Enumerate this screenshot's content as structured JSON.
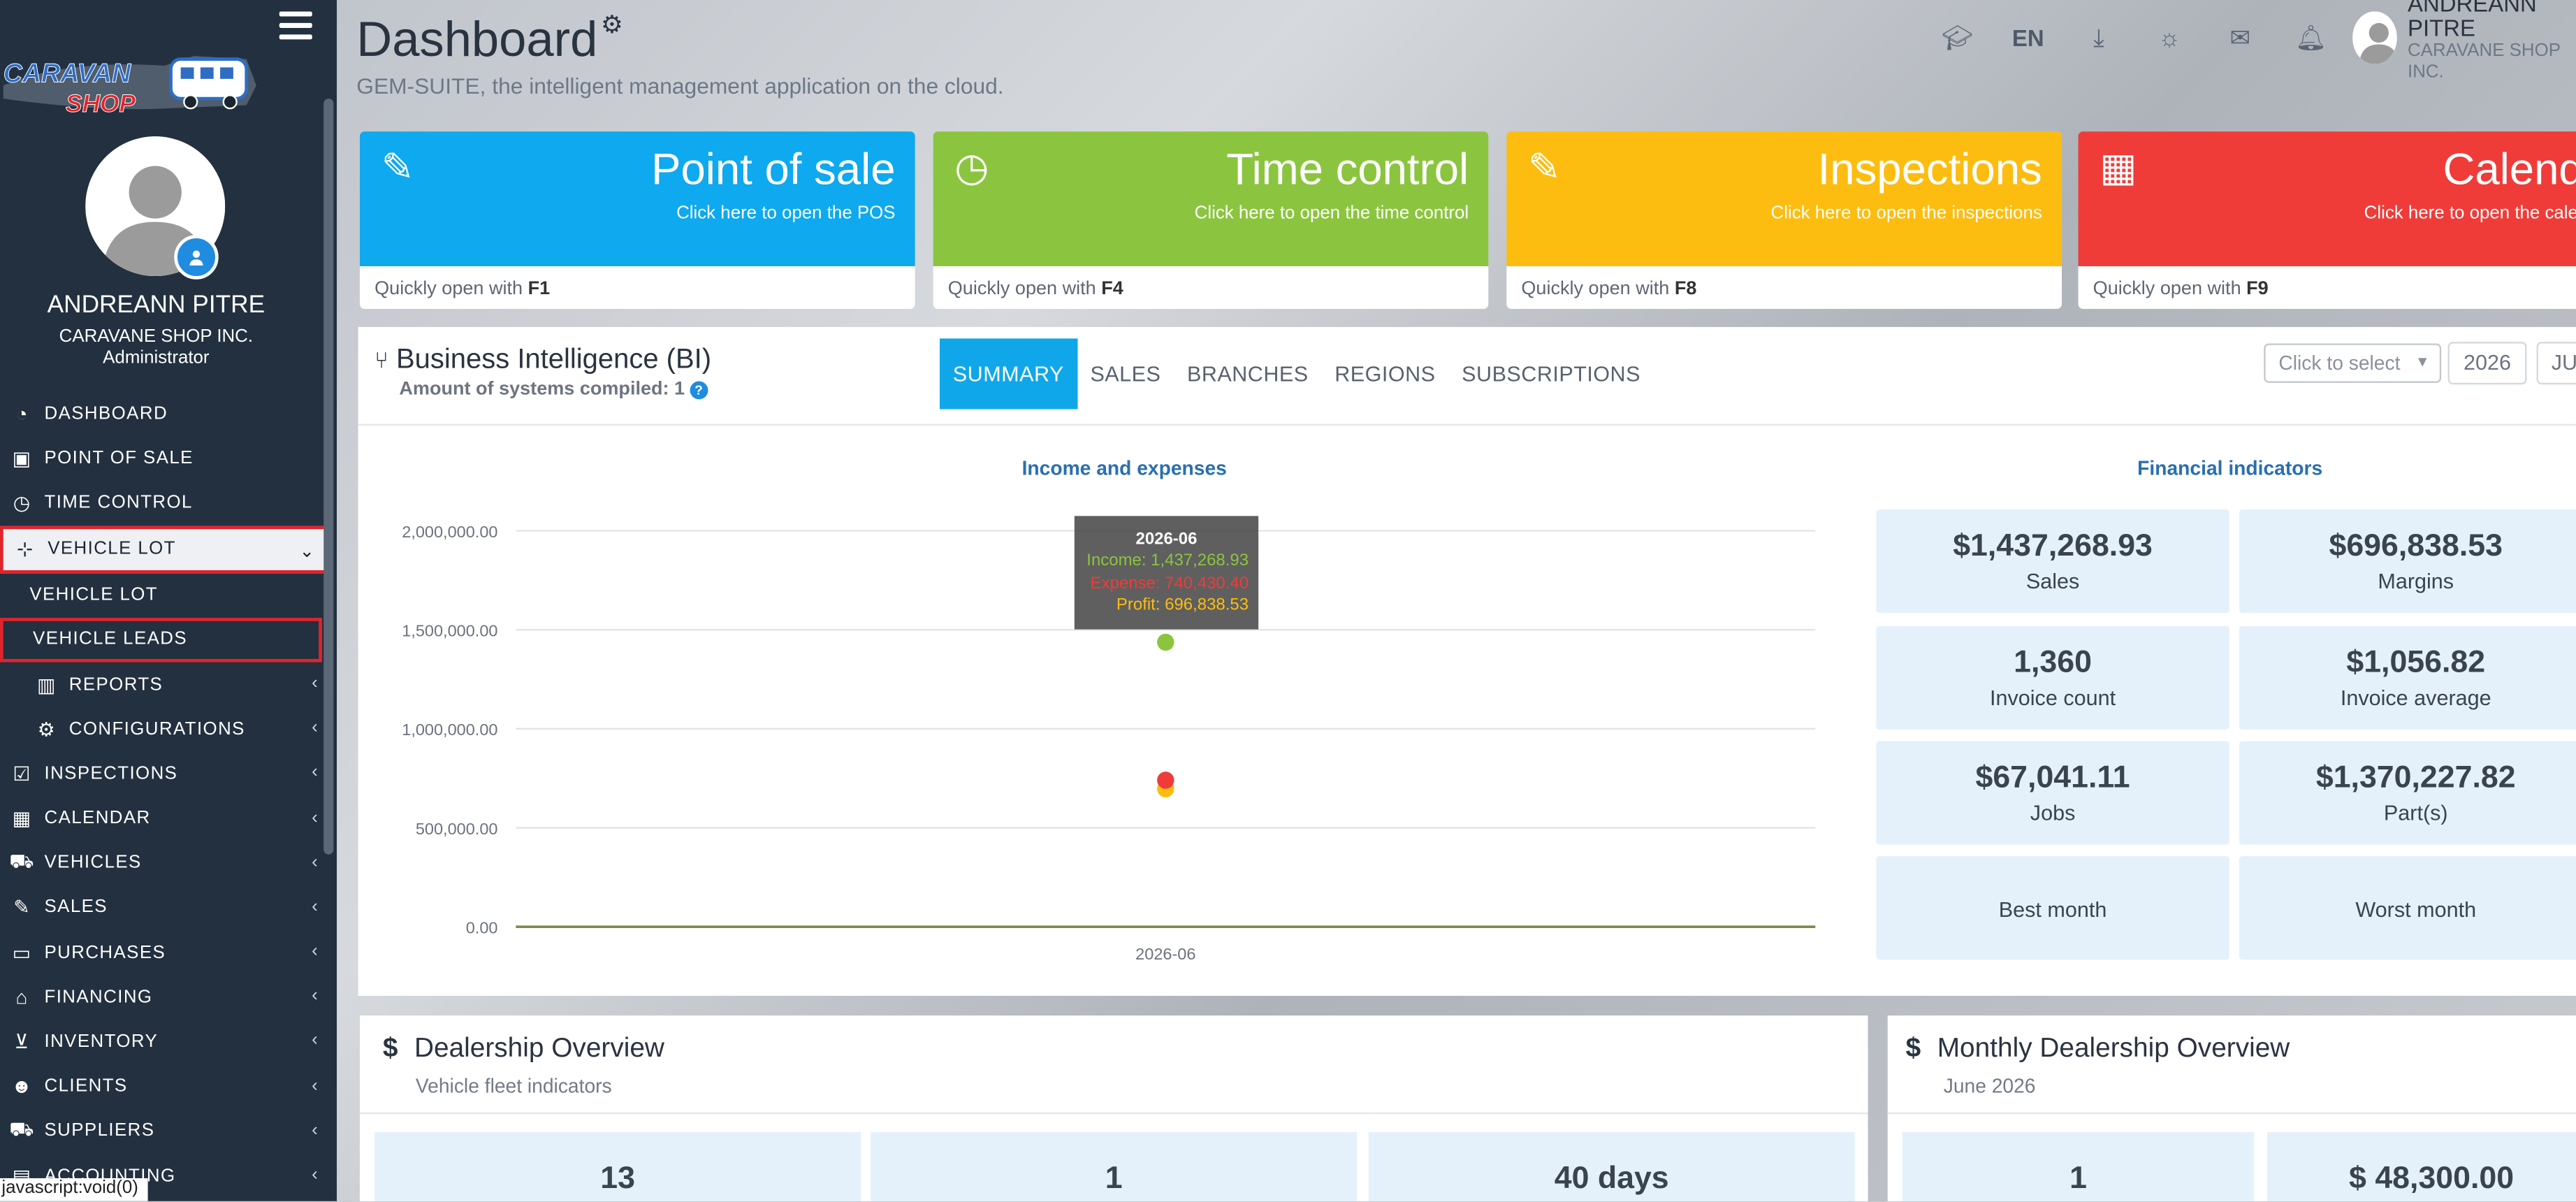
{
  "sidebar": {
    "logo_text": "CARAVANE SHOP",
    "user_name": "ANDREANN PITRE",
    "company": "CARAVANE SHOP INC.",
    "role": "Administrator",
    "menu": [
      {
        "icon": "dashboard-icon",
        "label": "DASHBOARD",
        "chevron": false
      },
      {
        "icon": "cash-register-icon",
        "label": "POINT OF SALE",
        "chevron": false
      },
      {
        "icon": "clock-icon",
        "label": "TIME CONTROL",
        "chevron": false
      },
      {
        "icon": "sitemap-icon",
        "label": "VEHICLE LOT",
        "chevron": true,
        "expanded": true
      },
      {
        "icon": "",
        "label": "VEHICLE LOT",
        "chevron": false
      },
      {
        "icon": "",
        "label": "VEHICLE LEADS",
        "chevron": false
      },
      {
        "icon": "bar-chart-icon",
        "label": "REPORTS",
        "chevron": true
      },
      {
        "icon": "gear-icon",
        "label": "CONFIGURATIONS",
        "chevron": true
      },
      {
        "icon": "checkbox-icon",
        "label": "INSPECTIONS",
        "chevron": true
      },
      {
        "icon": "calendar-icon",
        "label": "CALENDAR",
        "chevron": true
      },
      {
        "icon": "car-icon",
        "label": "VEHICLES",
        "chevron": true
      },
      {
        "icon": "edit-icon",
        "label": "SALES",
        "chevron": true
      },
      {
        "icon": "credit-card-icon",
        "label": "PURCHASES",
        "chevron": true
      },
      {
        "icon": "bank-icon",
        "label": "FINANCING",
        "chevron": true
      },
      {
        "icon": "cart-icon",
        "label": "INVENTORY",
        "chevron": true
      },
      {
        "icon": "users-icon",
        "label": "CLIENTS",
        "chevron": true
      },
      {
        "icon": "truck-icon",
        "label": "SUPPLIERS",
        "chevron": true
      },
      {
        "icon": "accounting-icon",
        "label": "ACCOUNTING",
        "chevron": true
      }
    ],
    "status_text": "javascript:void(0)"
  },
  "header": {
    "title": "Dashboard",
    "subtitle": "GEM-SUITE, the intelligent management application on the cloud.",
    "lang": "EN",
    "user_name": "ANDREANN PITRE",
    "user_company": "CARAVANE SHOP INC."
  },
  "tiles": [
    {
      "title": "Point of sale",
      "sub": "Click here to open the POS",
      "shortcut_prefix": "Quickly open with ",
      "key": "F1",
      "color": "#0ea9ee"
    },
    {
      "title": "Time control",
      "sub": "Click here to open the time control",
      "shortcut_prefix": "Quickly open with ",
      "key": "F4",
      "color": "#8bc53f"
    },
    {
      "title": "Inspections",
      "sub": "Click here to open the inspections",
      "shortcut_prefix": "Quickly open with ",
      "key": "F8",
      "color": "#fdbd10"
    },
    {
      "title": "Calendar",
      "sub": "Click here to open the calendar",
      "shortcut_prefix": "Quickly open with ",
      "key": "F9",
      "color": "#ef3c39"
    }
  ],
  "bi": {
    "title": "Business Intelligence (BI)",
    "compiled_label": "Amount of systems compiled: 1",
    "tabs": [
      "SUMMARY",
      "SALES",
      "BRANCHES",
      "REGIONS",
      "SUBSCRIPTIONS"
    ],
    "select_placeholder": "Click to select",
    "year": "2026",
    "month": "JU",
    "chart_title": "Income and expenses",
    "financial_title": "Financial indicators"
  },
  "tooltip": {
    "date": "2026-06",
    "income": "Income: 1,437,268.93",
    "expense": "Expense: 740,430.40",
    "profit": "Profit: 696,838.53"
  },
  "chart_data": {
    "type": "scatter",
    "title": "Income and expenses",
    "categories": [
      "2026-06"
    ],
    "ylim": [
      0,
      2000000
    ],
    "y_ticks": [
      "0.00",
      "500,000.00",
      "1,000,000.00",
      "1,500,000.00",
      "2,000,000.00"
    ],
    "series": [
      {
        "name": "Income",
        "values": [
          1437268.93
        ],
        "color": "#8bc53f"
      },
      {
        "name": "Expense",
        "values": [
          740430.4
        ],
        "color": "#ef3c39"
      },
      {
        "name": "Profit",
        "values": [
          696838.53
        ],
        "color": "#fdbd10"
      }
    ]
  },
  "indicators": [
    {
      "value": "$1,437,268.93",
      "label": "Sales"
    },
    {
      "value": "$696,838.53",
      "label": "Margins"
    },
    {
      "value": "1,360",
      "label": "Invoice count"
    },
    {
      "value": "$1,056.82",
      "label": "Invoice average"
    },
    {
      "value": "$67,041.11",
      "label": "Jobs"
    },
    {
      "value": "$1,370,227.82",
      "label": "Part(s)"
    },
    {
      "value": "",
      "label": "Best month"
    },
    {
      "value": "",
      "label": "Worst month"
    }
  ],
  "dealership": {
    "title": "Dealership Overview",
    "subtitle": "Vehicle fleet indicators",
    "values": [
      "13",
      "1",
      "40 days"
    ]
  },
  "monthly": {
    "title": "Monthly Dealership Overview",
    "subtitle": "June 2026",
    "values": [
      "1",
      "$ 48,300.00"
    ]
  }
}
